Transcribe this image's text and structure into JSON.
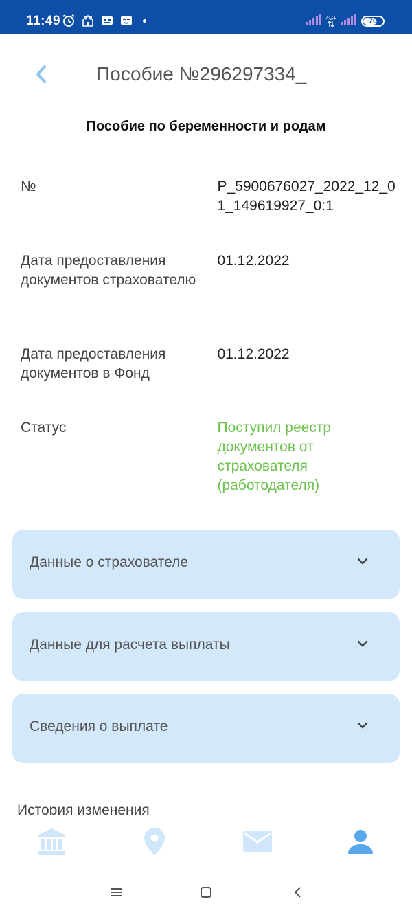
{
  "status_bar": {
    "time": "11:49",
    "network": "4G+",
    "battery": "70",
    "battery_level": 0.7
  },
  "header": {
    "title": "Пособие №296297334_"
  },
  "section_title": "Пособие по беременности и родам",
  "details": [
    {
      "label": "№",
      "value": "P_5900676027_2022_12_01_149619927_0:1"
    },
    {
      "label": "Дата предоставления документов страхователю",
      "value": "01.12.2022"
    },
    {
      "label": "Дата предоставления документов в Фонд",
      "value": "01.12.2022"
    },
    {
      "label": "Статус",
      "value": "Поступил реестр документов от страхователя (работодателя)"
    }
  ],
  "accordions": [
    {
      "label": "Данные о страхователе"
    },
    {
      "label": "Данные для расчета выплаты"
    },
    {
      "label": "Сведения о выплате"
    }
  ],
  "history_label": "История изменения",
  "tabs": [
    {
      "icon": "bank-icon"
    },
    {
      "icon": "location-pin-icon"
    },
    {
      "icon": "mail-icon"
    },
    {
      "icon": "profile-icon",
      "active": true
    }
  ],
  "colors": {
    "status_bar_bg": "#0d4ea6",
    "accordion_bg": "#d3e8fb",
    "status_green": "#6bc24d",
    "tab_inactive": "#cfe6fb",
    "tab_active": "#5aa8ec",
    "back_arrow": "#8fc3ef"
  }
}
